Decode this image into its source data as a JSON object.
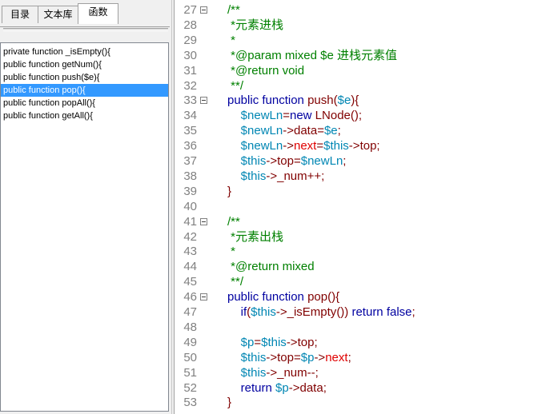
{
  "tabs": [
    {
      "label": "目录",
      "active": false
    },
    {
      "label": "文本库",
      "active": false
    },
    {
      "label": "函数",
      "active": true
    }
  ],
  "functions": [
    {
      "label": "private function _isEmpty(){",
      "selected": false
    },
    {
      "label": "public function getNum(){",
      "selected": false
    },
    {
      "label": "public function push($e){",
      "selected": false
    },
    {
      "label": "public function pop(){",
      "selected": true
    },
    {
      "label": "public function popAll(){",
      "selected": false
    },
    {
      "label": "public function getAll(){",
      "selected": false
    }
  ],
  "colors": {
    "comment": "#008000",
    "keyword": "#0000a0",
    "variable": "#0086b3",
    "operator": "#800000",
    "property": "#e00000",
    "selection": "#3399ff"
  },
  "icons": {
    "fold": "fold-minus-icon"
  },
  "code_lines": [
    {
      "n": "27",
      "fold": true,
      "indent": "",
      "tokens": [
        [
          "c",
          "/**"
        ]
      ]
    },
    {
      "n": "28",
      "fold": false,
      "indent": " ",
      "tokens": [
        [
          "c",
          "*元素进栈"
        ]
      ]
    },
    {
      "n": "29",
      "fold": false,
      "indent": " ",
      "tokens": [
        [
          "c",
          "*"
        ]
      ]
    },
    {
      "n": "30",
      "fold": false,
      "indent": " ",
      "tokens": [
        [
          "c",
          "*@param mixed $e 进栈元素值"
        ]
      ]
    },
    {
      "n": "31",
      "fold": false,
      "indent": " ",
      "tokens": [
        [
          "c",
          "*@return void"
        ]
      ]
    },
    {
      "n": "32",
      "fold": false,
      "indent": " ",
      "tokens": [
        [
          "c",
          "**/"
        ]
      ]
    },
    {
      "n": "33",
      "fold": true,
      "indent": "",
      "tokens": [
        [
          "k",
          "public function "
        ],
        [
          "f",
          "push"
        ],
        [
          "o",
          "("
        ],
        [
          "v",
          "$e"
        ],
        [
          "o",
          "){"
        ]
      ]
    },
    {
      "n": "34",
      "fold": false,
      "indent": "    ",
      "tokens": [
        [
          "v",
          "$newLn"
        ],
        [
          "o",
          "="
        ],
        [
          "k",
          "new "
        ],
        [
          "f",
          "LNode"
        ],
        [
          "o",
          "();"
        ]
      ]
    },
    {
      "n": "35",
      "fold": false,
      "indent": "    ",
      "tokens": [
        [
          "v",
          "$newLn"
        ],
        [
          "o",
          "->"
        ],
        [
          "f",
          "data"
        ],
        [
          "o",
          "="
        ],
        [
          "v",
          "$e"
        ],
        [
          "o",
          ";"
        ]
      ]
    },
    {
      "n": "36",
      "fold": false,
      "indent": "    ",
      "tokens": [
        [
          "v",
          "$newLn"
        ],
        [
          "o",
          "->"
        ],
        [
          "r",
          "next"
        ],
        [
          "o",
          "="
        ],
        [
          "v",
          "$this"
        ],
        [
          "o",
          "->"
        ],
        [
          "f",
          "top"
        ],
        [
          "o",
          ";"
        ]
      ]
    },
    {
      "n": "37",
      "fold": false,
      "indent": "    ",
      "tokens": [
        [
          "v",
          "$this"
        ],
        [
          "o",
          "->"
        ],
        [
          "f",
          "top"
        ],
        [
          "o",
          "="
        ],
        [
          "v",
          "$newLn"
        ],
        [
          "o",
          ";"
        ]
      ]
    },
    {
      "n": "38",
      "fold": false,
      "indent": "    ",
      "tokens": [
        [
          "v",
          "$this"
        ],
        [
          "o",
          "->"
        ],
        [
          "f",
          "_num"
        ],
        [
          "o",
          "++;"
        ]
      ]
    },
    {
      "n": "39",
      "fold": false,
      "indent": "",
      "tokens": [
        [
          "o",
          "}"
        ]
      ]
    },
    {
      "n": "40",
      "fold": false,
      "indent": "",
      "tokens": []
    },
    {
      "n": "41",
      "fold": true,
      "indent": "",
      "tokens": [
        [
          "c",
          "/**"
        ]
      ]
    },
    {
      "n": "42",
      "fold": false,
      "indent": " ",
      "tokens": [
        [
          "c",
          "*元素出栈"
        ]
      ]
    },
    {
      "n": "43",
      "fold": false,
      "indent": " ",
      "tokens": [
        [
          "c",
          "*"
        ]
      ]
    },
    {
      "n": "44",
      "fold": false,
      "indent": " ",
      "tokens": [
        [
          "c",
          "*@return mixed"
        ]
      ]
    },
    {
      "n": "45",
      "fold": false,
      "indent": " ",
      "tokens": [
        [
          "c",
          "**/"
        ]
      ]
    },
    {
      "n": "46",
      "fold": true,
      "indent": "",
      "tokens": [
        [
          "k",
          "public function "
        ],
        [
          "f",
          "pop"
        ],
        [
          "o",
          "(){"
        ]
      ]
    },
    {
      "n": "47",
      "fold": false,
      "indent": "    ",
      "tokens": [
        [
          "k",
          "if"
        ],
        [
          "o",
          "("
        ],
        [
          "v",
          "$this"
        ],
        [
          "o",
          "->"
        ],
        [
          "f",
          "_isEmpty"
        ],
        [
          "o",
          "()) "
        ],
        [
          "k",
          "return false"
        ],
        [
          "o",
          ";"
        ]
      ]
    },
    {
      "n": "48",
      "fold": false,
      "indent": "",
      "tokens": []
    },
    {
      "n": "49",
      "fold": false,
      "indent": "    ",
      "tokens": [
        [
          "v",
          "$p"
        ],
        [
          "o",
          "="
        ],
        [
          "v",
          "$this"
        ],
        [
          "o",
          "->"
        ],
        [
          "f",
          "top"
        ],
        [
          "o",
          ";"
        ]
      ]
    },
    {
      "n": "50",
      "fold": false,
      "indent": "    ",
      "tokens": [
        [
          "v",
          "$this"
        ],
        [
          "o",
          "->"
        ],
        [
          "f",
          "top"
        ],
        [
          "o",
          "="
        ],
        [
          "v",
          "$p"
        ],
        [
          "o",
          "->"
        ],
        [
          "r",
          "next"
        ],
        [
          "o",
          ";"
        ]
      ]
    },
    {
      "n": "51",
      "fold": false,
      "indent": "    ",
      "tokens": [
        [
          "v",
          "$this"
        ],
        [
          "o",
          "->"
        ],
        [
          "f",
          "_num"
        ],
        [
          "o",
          "--;"
        ]
      ]
    },
    {
      "n": "52",
      "fold": false,
      "indent": "    ",
      "tokens": [
        [
          "k",
          "return "
        ],
        [
          "v",
          "$p"
        ],
        [
          "o",
          "->"
        ],
        [
          "f",
          "data"
        ],
        [
          "o",
          ";"
        ]
      ]
    },
    {
      "n": "53",
      "fold": false,
      "indent": "",
      "tokens": [
        [
          "o",
          "}"
        ]
      ]
    }
  ]
}
